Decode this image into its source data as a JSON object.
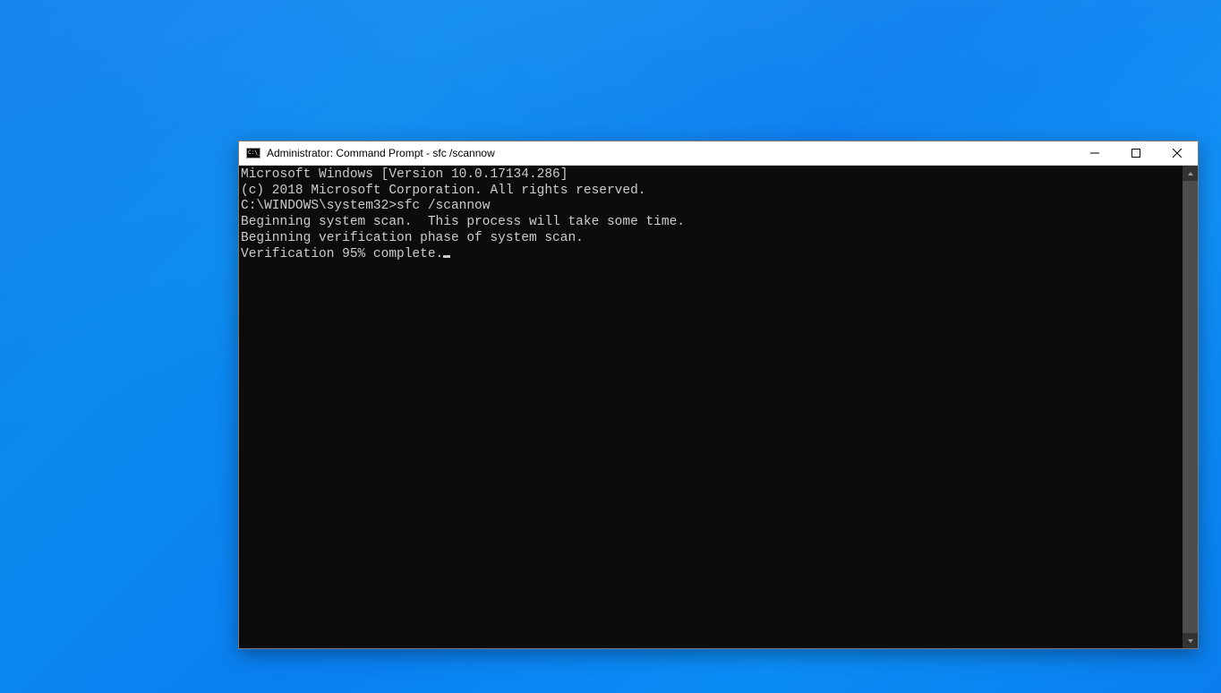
{
  "window": {
    "title": "Administrator: Command Prompt - sfc  /scannow"
  },
  "terminal": {
    "lines": [
      "Microsoft Windows [Version 10.0.17134.286]",
      "(c) 2018 Microsoft Corporation. All rights reserved.",
      "",
      "C:\\WINDOWS\\system32>sfc /scannow",
      "",
      "Beginning system scan.  This process will take some time.",
      "",
      "Beginning verification phase of system scan.",
      "Verification 95% complete."
    ]
  }
}
